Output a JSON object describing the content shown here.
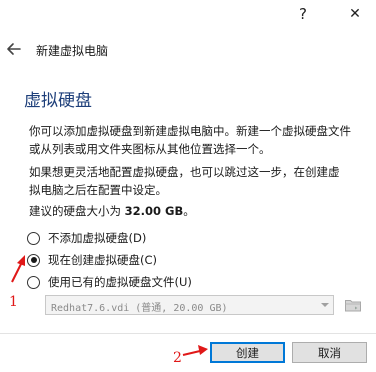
{
  "titlebar": {
    "help_label": "?",
    "close_label": "✕"
  },
  "header": {
    "title": "新建虚拟电脑",
    "back_icon": "back-arrow-icon"
  },
  "page": {
    "heading": "虚拟硬盘",
    "para1_line1": "你可以添加虚拟硬盘到新建虚拟电脑中。新建一个虚拟硬盘文件",
    "para1_line2": "或从列表或用文件夹图标从其他位置选择一个。",
    "para2_line1": "如果想更灵活地配置虚拟硬盘，也可以跳过这一步，在创建虚",
    "para2_line2": "拟电脑之后在配置中设定。",
    "recommend_prefix": "建议的硬盘大小为 ",
    "recommend_size": "32.00 GB",
    "recommend_suffix": "。"
  },
  "options": [
    {
      "label": "不添加虚拟硬盘(D)",
      "checked": false
    },
    {
      "label": "现在创建虚拟硬盘(C)",
      "checked": true
    },
    {
      "label": "使用已有的虚拟硬盘文件(U)",
      "checked": false
    }
  ],
  "file_select": {
    "value": "Redhat7.6.vdi (普通, 20.00 GB)",
    "enabled": false,
    "folder_icon": "folder-icon"
  },
  "buttons": {
    "create": "创建",
    "cancel": "取消"
  },
  "annotations": {
    "one": "1",
    "two": "2",
    "color": "#e01818"
  },
  "colors": {
    "heading": "#1e3f7a",
    "focus_border": "#0078d7"
  }
}
